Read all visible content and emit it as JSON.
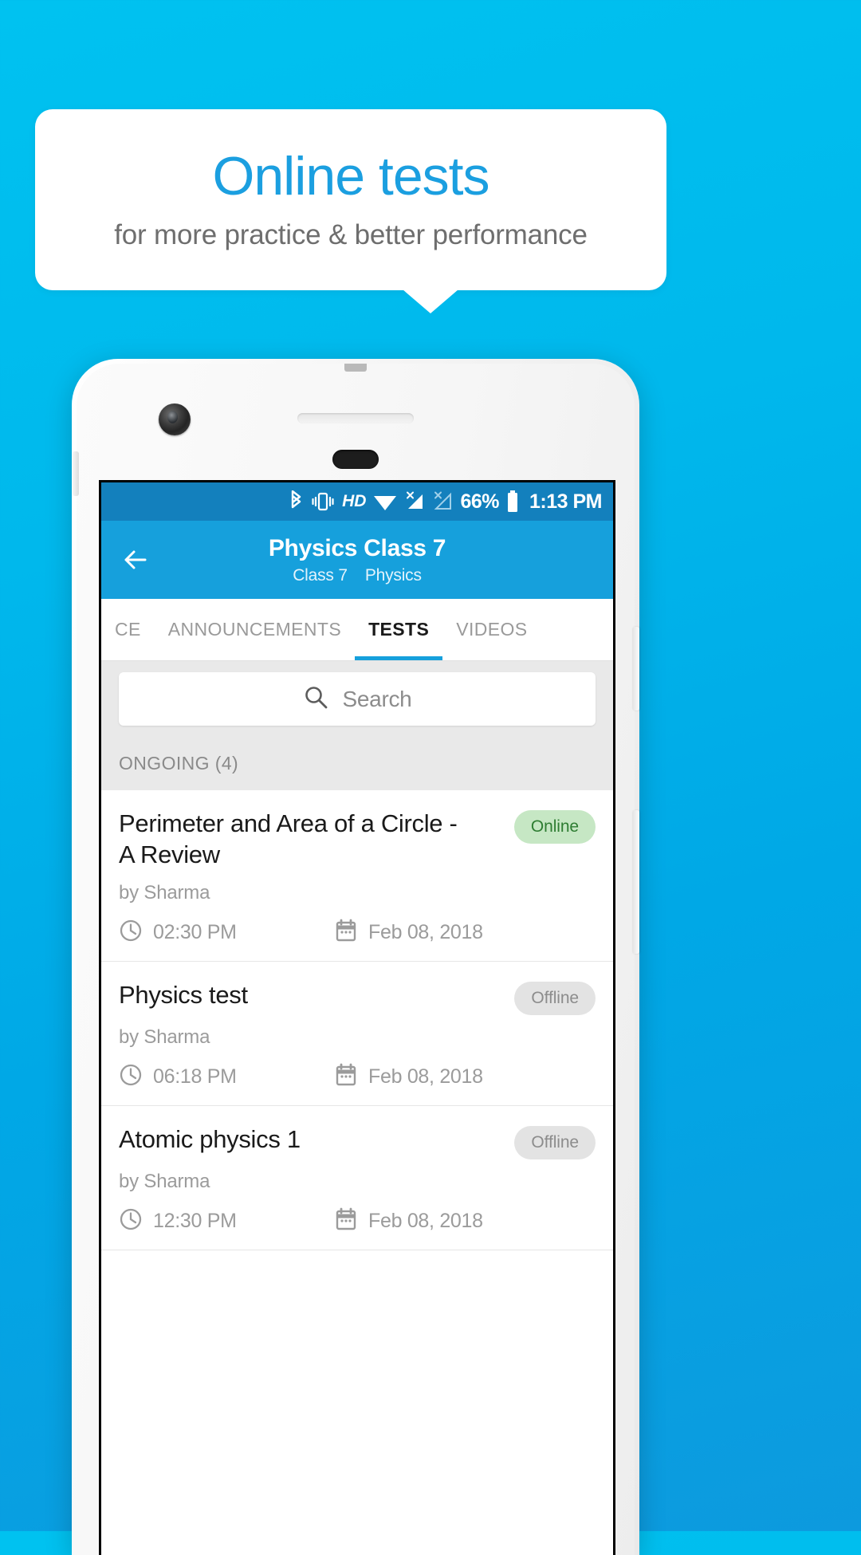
{
  "banner": {
    "title": "Online tests",
    "subtitle": "for more practice & better performance",
    "title_color": "#1b9fe0",
    "subtitle_color": "#6e6e6e"
  },
  "background": {
    "color_top": "#00c2f0",
    "color_bottom": "#0d9ade"
  },
  "statusbar": {
    "icons": [
      "bluetooth-icon",
      "vibrate-icon",
      "hd-icon",
      "wifi-icon",
      "signal-1-no-sim-icon",
      "signal-2-no-sim-icon"
    ],
    "hd_label": "HD",
    "battery_percent": "66%",
    "time": "1:13 PM"
  },
  "appbar": {
    "back_icon": "back-arrow-icon",
    "title": "Physics Class 7",
    "subtitle_class": "Class 7",
    "subtitle_subject": "Physics",
    "color": "#16a0dc"
  },
  "tabs": [
    {
      "label": "CE",
      "active": false
    },
    {
      "label": "ANNOUNCEMENTS",
      "active": false
    },
    {
      "label": "TESTS",
      "active": true
    },
    {
      "label": "VIDEOS",
      "active": false
    }
  ],
  "search": {
    "placeholder": "Search",
    "value": "",
    "icon": "search-icon"
  },
  "section": {
    "label": "ONGOING (4)",
    "count": 4
  },
  "tests": [
    {
      "title": "Perimeter and Area of a Circle - A Review",
      "author": "by Sharma",
      "status": "Online",
      "status_type": "online",
      "time": "02:30 PM",
      "date": "Feb 08, 2018"
    },
    {
      "title": "Physics test",
      "author": "by Sharma",
      "status": "Offline",
      "status_type": "offline",
      "time": "06:18 PM",
      "date": "Feb 08, 2018"
    },
    {
      "title": "Atomic physics 1",
      "author": "by Sharma",
      "status": "Offline",
      "status_type": "offline",
      "time": "12:30 PM",
      "date": "Feb 08, 2018"
    }
  ],
  "colors": {
    "accent": "#16a0dc",
    "status_bar": "#1380bd",
    "badge_online_bg": "#c6e7c4",
    "badge_online_text": "#2e7d32",
    "badge_offline_bg": "#e3e3e3",
    "badge_offline_text": "#8c8c8c"
  }
}
